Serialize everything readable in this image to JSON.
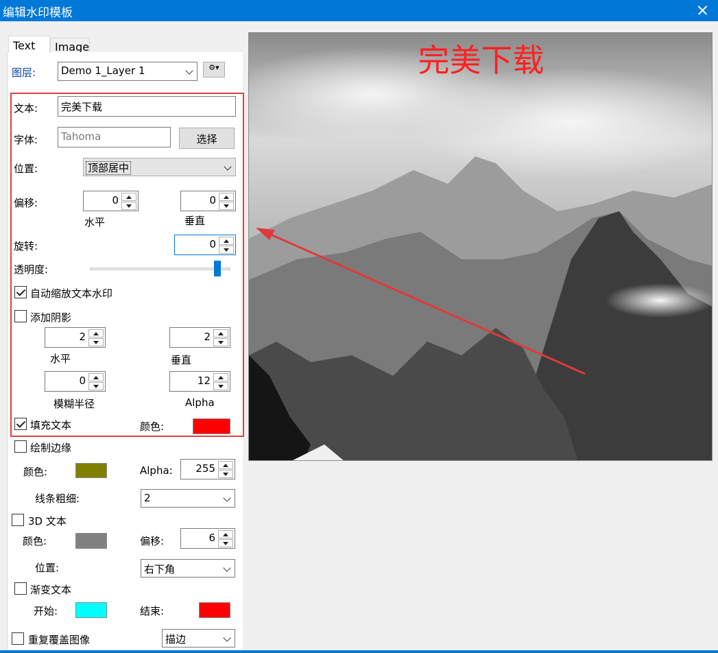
{
  "window": {
    "title": "编辑水印模板",
    "close_icon": "close-icon"
  },
  "tabs": [
    {
      "label": "Text"
    },
    {
      "label": "Image"
    }
  ],
  "layer": {
    "label": "图层:",
    "selected": "Demo 1_Layer 1",
    "gear_icon": "gear-icon"
  },
  "text": {
    "label": "文本:",
    "value": "完美下载"
  },
  "font": {
    "label": "字体:",
    "value": "Tahoma",
    "button": "选择"
  },
  "position": {
    "label": "位置:",
    "selected": "顶部居中"
  },
  "offset": {
    "label": "偏移:",
    "horizontal": "0",
    "vertical": "0",
    "h_label": "水平",
    "v_label": "垂直"
  },
  "rotation": {
    "label": "旋转:",
    "value": "0"
  },
  "opacity": {
    "label": "透明度:",
    "level": 0.93
  },
  "auto_scale": {
    "label": "自动缩放文本水印",
    "checked": true
  },
  "shadow": {
    "label": "添加阴影",
    "checked": false,
    "horizontal": "2",
    "vertical": "2",
    "h_label": "水平",
    "v_label": "垂直",
    "blur": "0",
    "alpha": "12",
    "blur_label": "模糊半径",
    "alpha_label": "Alpha"
  },
  "fill": {
    "label": "填充文本",
    "checked": true,
    "color_label": "颜色:",
    "color": "#ff0000"
  },
  "border": {
    "label": "绘制边缘",
    "checked": false,
    "color_label": "颜色:",
    "color": "#808000",
    "alpha_label": "Alpha:",
    "alpha": "255",
    "width_label": "线条粗细:",
    "width": "2"
  },
  "text3d": {
    "label": "3D 文本",
    "checked": false,
    "color_label": "颜色:",
    "color": "#808080",
    "offset_label": "偏移:",
    "offset": "6",
    "position_label": "位置:",
    "position": "右下角"
  },
  "gradient": {
    "label": "渐变文本",
    "checked": false,
    "start_label": "开始:",
    "start_color": "#00ffff",
    "end_label": "结束:",
    "end_color": "#ff0000"
  },
  "repeat": {
    "label": "重复覆盖图像",
    "checked": false,
    "mode": "描边"
  },
  "preview": {
    "watermark": "完美下载",
    "watermark_color": "#ff2020"
  },
  "colors": {
    "accent": "#0078d7",
    "highlight": "#e04040"
  }
}
